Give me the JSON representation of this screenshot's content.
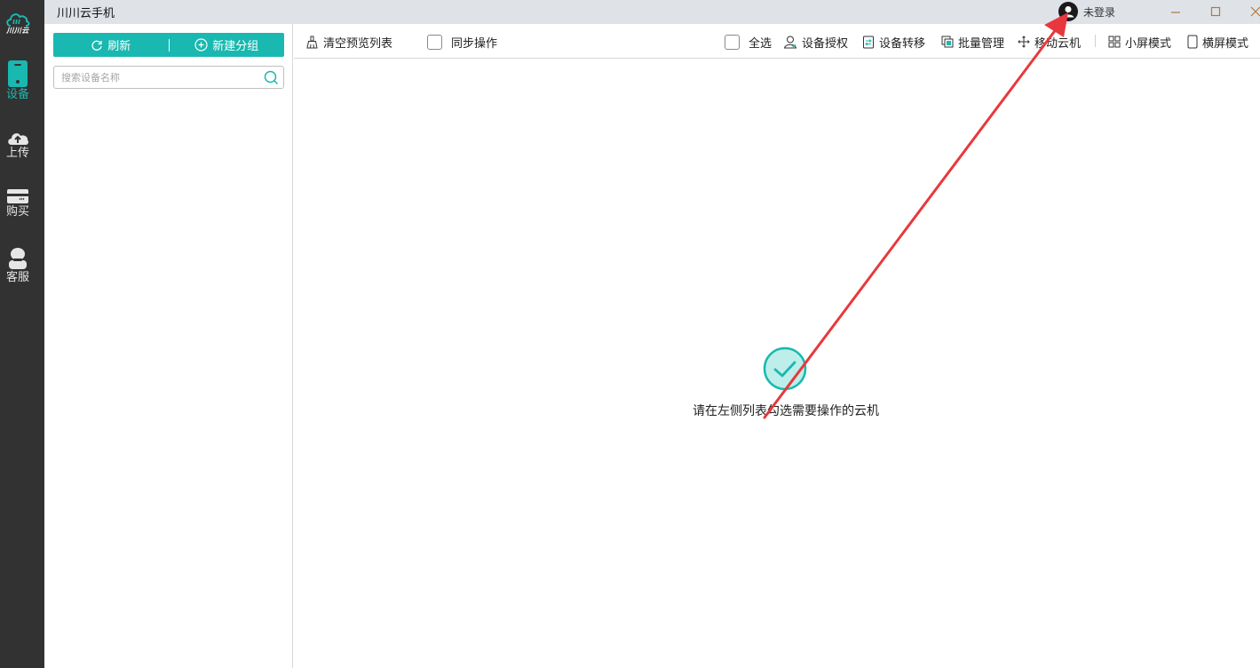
{
  "window": {
    "title": "川川云手机",
    "user_label": "未登录"
  },
  "rail": {
    "logo_text": "川川云",
    "items": [
      {
        "label": "设备",
        "icon": "phone-icon"
      },
      {
        "label": "上传",
        "icon": "cloud-upload-icon"
      },
      {
        "label": "购买",
        "icon": "card-icon"
      },
      {
        "label": "客服",
        "icon": "customer-service-icon"
      }
    ]
  },
  "device_panel": {
    "refresh_label": "刷新",
    "new_group_label": "新建分组",
    "search_placeholder": "搜索设备名称"
  },
  "toolbar": {
    "clear_preview": "清空预览列表",
    "sync_operation": "同步操作",
    "select_all": "全选",
    "device_auth": "设备授权",
    "device_transfer": "设备转移",
    "batch_manage": "批量管理",
    "move_cloud": "移动云机",
    "small_screen": "小屏模式",
    "landscape": "横屏模式"
  },
  "empty_state": {
    "message": "请在左侧列表勾选需要操作的云机"
  },
  "colors": {
    "accent": "#19b8b0",
    "rail_bg": "#323232",
    "titlebar_bg": "#dfe3e8",
    "annotation_arrow": "#e8383d"
  }
}
